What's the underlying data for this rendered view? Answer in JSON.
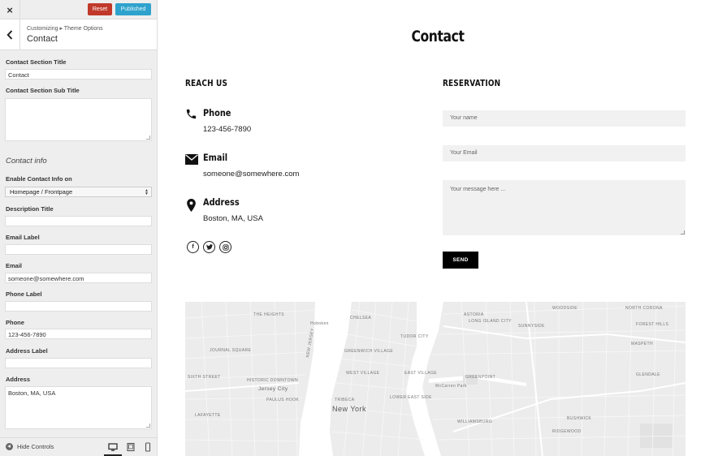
{
  "sidebar": {
    "close_glyph": "×",
    "reset_label": "Reset",
    "published_label": "Published",
    "breadcrumb": "Customizing ▸ Theme Options",
    "section_title": "Contact",
    "contact_section_title_label": "Contact Section Title",
    "contact_section_title_value": "Contact",
    "contact_section_subtitle_label": "Contact Section Sub Title",
    "contact_section_subtitle_value": "",
    "contact_info_heading": "Contact info",
    "enable_label": "Enable Contact Info on",
    "enable_value": "Homepage / Frontpage",
    "description_title_label": "Description Title",
    "description_title_value": "",
    "email_label_label": "Email Label",
    "email_label_value": "",
    "email_label": "Email",
    "email_value": "someone@somewhere.com",
    "phone_label_label": "Phone Label",
    "phone_label_value": "",
    "phone_label": "Phone",
    "phone_value": "123-456-7890",
    "address_label_label": "Address Label",
    "address_label_value": "",
    "address_label": "Address",
    "address_value": "Boston, MA, USA",
    "hide_controls_label": "Hide Controls"
  },
  "preview": {
    "page_title": "Contact",
    "reach_us_heading": "REACH US",
    "reservation_heading": "RESERVATION",
    "phone_title": "Phone",
    "phone_value": "123-456-7890",
    "email_title": "Email",
    "email_value": "someone@somewhere.com",
    "address_title": "Address",
    "address_value": "Boston, MA, USA",
    "social": [
      "f",
      "t",
      "◎"
    ],
    "form": {
      "name_placeholder": "Your name",
      "email_placeholder": "Your Email",
      "message_placeholder": "Your message here ...",
      "send_label": "SEND"
    },
    "map_labels": {
      "the_heights": "THE HEIGHTS",
      "hoboken": "Hoboken",
      "chelsea": "CHELSEA",
      "woodside": "WOODSIDE",
      "north_corona": "NORTH CORONA",
      "astoria": "ASTORIA",
      "long_island_city": "LONG ISLAND CITY",
      "sunnyside": "SUNNYSIDE",
      "journal_square": "JOURNAL SQUARE",
      "greenwich_village": "GREENWICH VILLAGE",
      "maspeth": "MASPETH",
      "sixth_st": "SIXTH STREET",
      "west_village": "WEST VILLAGE",
      "east_village": "EAST VILLAGE",
      "greenpoint": "GREENPOINT",
      "historic_downtown": "HISTORIC DOWNTOWN",
      "jersey_city": "Jersey City",
      "paulus_hook": "PAULUS HOOK",
      "tribeca": "TRIBECA",
      "new_york": "New York",
      "williamsburg": "WILLIAMSBURG",
      "bushwick": "BUSHWICK",
      "lafayette": "LAFAYETTE",
      "ridgewood": "RIDGEWOOD",
      "new_jersey": "NEW JERSEY",
      "mccarren_park": "McCarren Park",
      "glendale": "GLENDALE",
      "forest_hills": "FOREST HILLS",
      "tudor_city": "TUDOR CITY",
      "lower_east_side": "LOWER EAST SIDE"
    }
  },
  "colors": {
    "reset_bg": "#c0392b",
    "published_bg": "#2ea2cc",
    "send_bg": "#000000",
    "sidebar_bg": "#eeeeee"
  }
}
